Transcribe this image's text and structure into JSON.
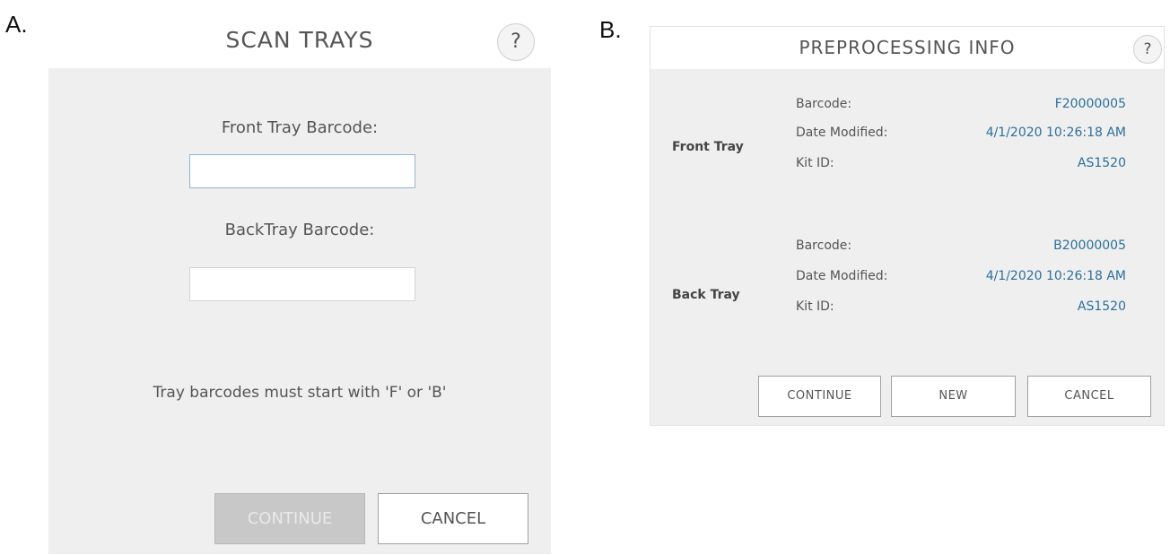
{
  "labels": {
    "panel_a": "A.",
    "panel_b": "B."
  },
  "scan_trays": {
    "title": "SCAN TRAYS",
    "help": "?",
    "front_label": "Front Tray Barcode:",
    "front_value": "",
    "back_label": "BackTray Barcode:",
    "back_value": "",
    "hint": "Tray barcodes must start with 'F' or 'B'",
    "continue_label": "CONTINUE",
    "cancel_label": "CANCEL"
  },
  "preprocessing": {
    "title": "PREPROCESSING INFO",
    "help": "?",
    "front": {
      "name": "Front Tray",
      "barcode_key": "Barcode:",
      "barcode_val": "F20000005",
      "date_key": "Date Modified:",
      "date_val": "4/1/2020 10:26:18 AM",
      "kit_key": "Kit ID:",
      "kit_val": "AS1520"
    },
    "back": {
      "name": "Back Tray",
      "barcode_key": "Barcode:",
      "barcode_val": "B20000005",
      "date_key": "Date Modified:",
      "date_val": "4/1/2020 10:26:18 AM",
      "kit_key": "Kit ID:",
      "kit_val": "AS1520"
    },
    "continue_label": "CONTINUE",
    "new_label": "NEW",
    "cancel_label": "CANCEL"
  },
  "colors": {
    "panel_bg": "#efefef",
    "header_bg": "#ffffff",
    "value_text": "#2b6f9a",
    "disabled_button": "#c8c8c8"
  }
}
